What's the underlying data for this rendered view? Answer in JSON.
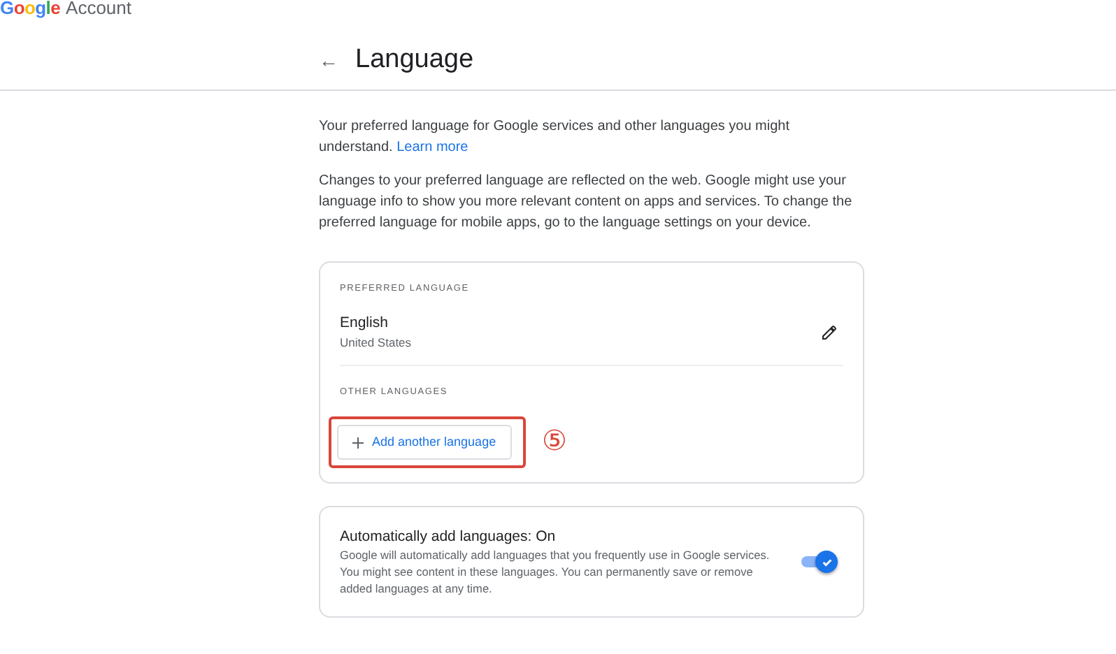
{
  "header": {
    "logo": "Google",
    "product": "Account"
  },
  "page": {
    "back_icon": "←",
    "title": "Language"
  },
  "intro": {
    "text": "Your preferred language for Google services and other languages you might understand.",
    "link": "Learn more"
  },
  "note": "Changes to your preferred language are reflected on the web. Google might use your language info to show you more relevant content on apps and services. To change the preferred language for mobile apps, go to the language settings on your device.",
  "languages_card": {
    "preferred_heading": "PREFERRED LANGUAGE",
    "preferred": {
      "name": "English",
      "region": "United States"
    },
    "other_heading": "OTHER LANGUAGES",
    "add_button": "Add another language",
    "annotation": {
      "highlighted": true,
      "marker": "⑤"
    }
  },
  "auto_card": {
    "title": "Automatically add languages: On",
    "description": "Google will automatically add languages that you frequently use in Google services. You might see content in these languages. You can permanently save or remove added languages at any time.",
    "on": true
  }
}
